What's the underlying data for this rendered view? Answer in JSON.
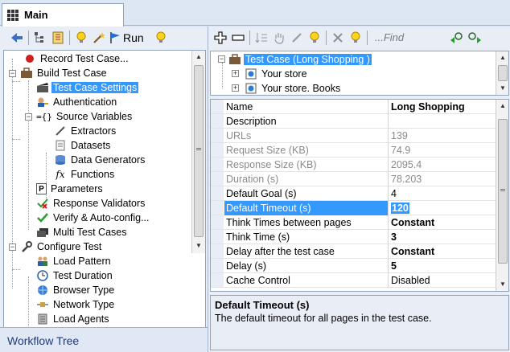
{
  "main_tab": {
    "label": "Main"
  },
  "left_toolbar": {
    "run_label": "Run"
  },
  "right_toolbar": {
    "find_placeholder": "...Find"
  },
  "workflow_tree": {
    "footer_label": "Workflow Tree",
    "items": [
      {
        "label": "Record Test Case..."
      },
      {
        "label": "Build Test Case"
      },
      {
        "label": "Test Case Settings"
      },
      {
        "label": "Authentication"
      },
      {
        "label": "Source Variables"
      },
      {
        "label": "Extractors"
      },
      {
        "label": "Datasets"
      },
      {
        "label": "Data Generators"
      },
      {
        "label": "Functions"
      },
      {
        "label": "Parameters"
      },
      {
        "label": "Response Validators"
      },
      {
        "label": "Verify & Auto-config..."
      },
      {
        "label": "Multi Test Cases"
      },
      {
        "label": "Configure Test"
      },
      {
        "label": "Load Pattern"
      },
      {
        "label": "Test Duration"
      },
      {
        "label": "Browser Type"
      },
      {
        "label": "Network Type"
      },
      {
        "label": "Load Agents"
      }
    ]
  },
  "test_case_tree": {
    "items": [
      {
        "label": "Test Case (Long Shopping )"
      },
      {
        "label": "Your store"
      },
      {
        "label": "Your store. Books"
      }
    ]
  },
  "properties": {
    "rows": [
      {
        "name": "Name",
        "value": "Long Shopping"
      },
      {
        "name": "Description",
        "value": ""
      },
      {
        "name": "URLs",
        "value": "139"
      },
      {
        "name": "Request Size (KB)",
        "value": "74.9"
      },
      {
        "name": "Response Size (KB)",
        "value": "2095.4"
      },
      {
        "name": "Duration (s)",
        "value": "78.203"
      },
      {
        "name": "Default Goal (s)",
        "value": "4"
      },
      {
        "name": "Default Timeout (s)",
        "value": "120"
      },
      {
        "name": "Think Times between pages",
        "value": "Constant"
      },
      {
        "name": "Think Time (s)",
        "value": "3"
      },
      {
        "name": "Delay after the test case",
        "value": "Constant"
      },
      {
        "name": "Delay (s)",
        "value": "5"
      },
      {
        "name": "Cache Control",
        "value": "Disabled"
      }
    ]
  },
  "description_panel": {
    "title": "Default Timeout (s)",
    "text": "The default timeout for all pages in the test case."
  },
  "colors": {
    "selection": "#3399ff",
    "panel_bg": "#e9eef6",
    "border": "#8fa3bc"
  }
}
